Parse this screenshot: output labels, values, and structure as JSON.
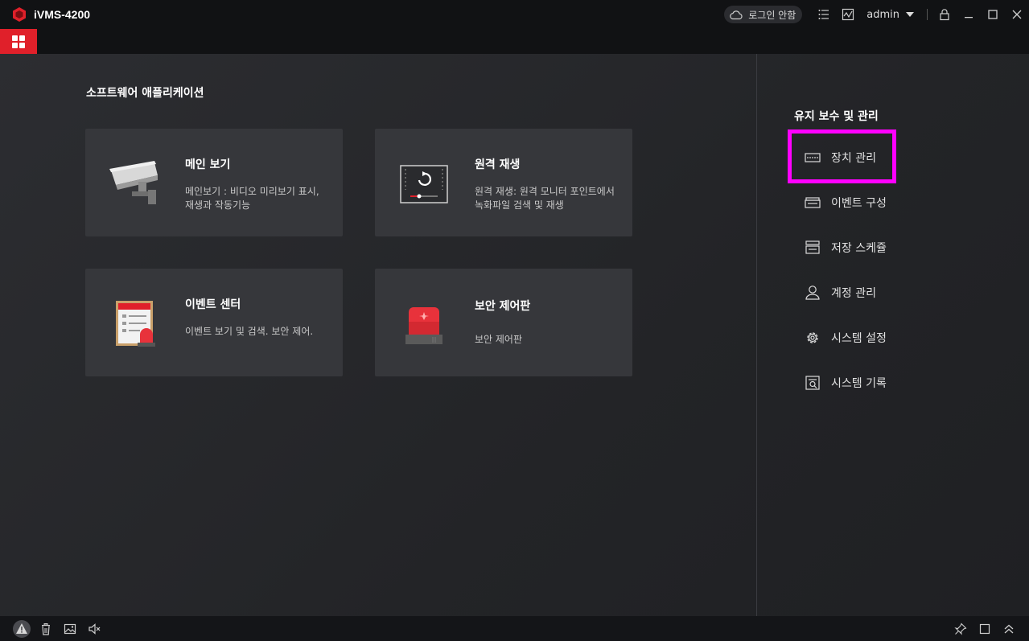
{
  "app": {
    "title": "iVMS-4200"
  },
  "header": {
    "login_status": "로그인 안함",
    "user": "admin"
  },
  "main": {
    "section_title": "소프트웨어 애플리케이션",
    "cards": [
      {
        "title": "메인 보기",
        "desc": "메인보기 : 비디오 미리보기 표시, 재생과 작동기능",
        "icon": "camera-icon"
      },
      {
        "title": "원격 재생",
        "desc": "원격 재생: 원격 모니터 포인트에서 녹화파일 검색 및 재생",
        "icon": "playback-icon"
      },
      {
        "title": "이벤트 센터",
        "desc": "이벤트 보기 및 검색. 보안 제어.",
        "icon": "event-center-icon"
      },
      {
        "title": "보안 제어판",
        "desc": "보안 제어판",
        "icon": "alarm-light-icon"
      }
    ]
  },
  "maintenance": {
    "title": "유지 보수 및 관리",
    "items": [
      {
        "label": "장치 관리",
        "icon": "device-icon"
      },
      {
        "label": "이벤트 구성",
        "icon": "event-config-icon"
      },
      {
        "label": "저장 스케쥴",
        "icon": "storage-icon"
      },
      {
        "label": "계정 관리",
        "icon": "user-icon"
      },
      {
        "label": "시스템 설정",
        "icon": "gear-icon"
      },
      {
        "label": "시스템 기록",
        "icon": "log-icon"
      }
    ]
  },
  "colors": {
    "accent": "#e0202a",
    "highlight": "#ff00ff"
  }
}
